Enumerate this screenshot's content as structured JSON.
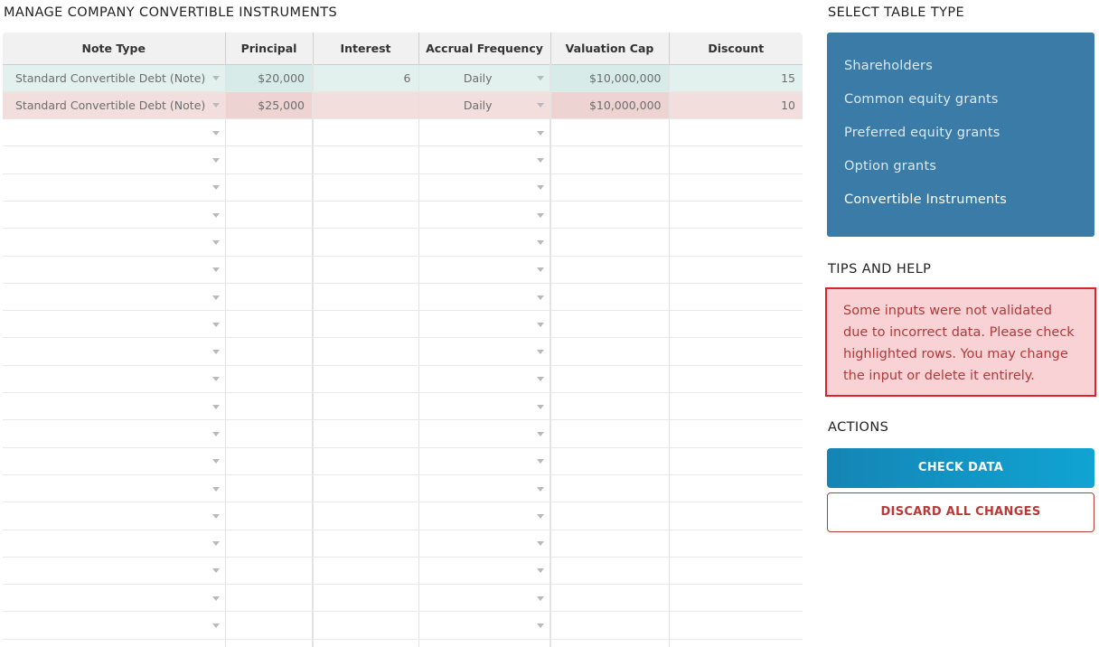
{
  "left_title": "MANAGE COMPANY CONVERTIBLE INSTRUMENTS",
  "columns": [
    "Note Type",
    "Principal",
    "Interest",
    "Accrual Frequency",
    "Valuation Cap",
    "Discount"
  ],
  "rows": [
    {
      "status": "valid",
      "note_type": "Standard Convertible Debt (Note)",
      "principal": "$20,000",
      "interest": "6",
      "accrual": "Daily",
      "valuation_cap": "$10,000,000",
      "discount": "15"
    },
    {
      "status": "invalid",
      "note_type": "Standard Convertible Debt (Note)",
      "principal": "$25,000",
      "interest": "",
      "accrual": "Daily",
      "valuation_cap": "$10,000,000",
      "discount": "10"
    }
  ],
  "empty_row_count": 20,
  "select_table_type": {
    "title": "SELECT TABLE TYPE",
    "items": [
      "Shareholders",
      "Common equity grants",
      "Preferred equity grants",
      "Option grants",
      "Convertible Instruments"
    ],
    "active": "Convertible Instruments"
  },
  "tips": {
    "title": "TIPS AND HELP",
    "message": "Some inputs were not validated due to incorrect data. Please check highlighted rows. You may change the input or delete it entirely."
  },
  "actions": {
    "title": "ACTIONS",
    "check_label": "CHECK DATA",
    "discard_label": "DISCARD ALL CHANGES"
  },
  "colors": {
    "panel_blue": "#3a7ba7",
    "valid_row": "#e2f0ee",
    "invalid_row": "#f3dede",
    "error_border": "#d9232e",
    "check_button": "#1294c4",
    "discard_text": "#b73a3a"
  }
}
